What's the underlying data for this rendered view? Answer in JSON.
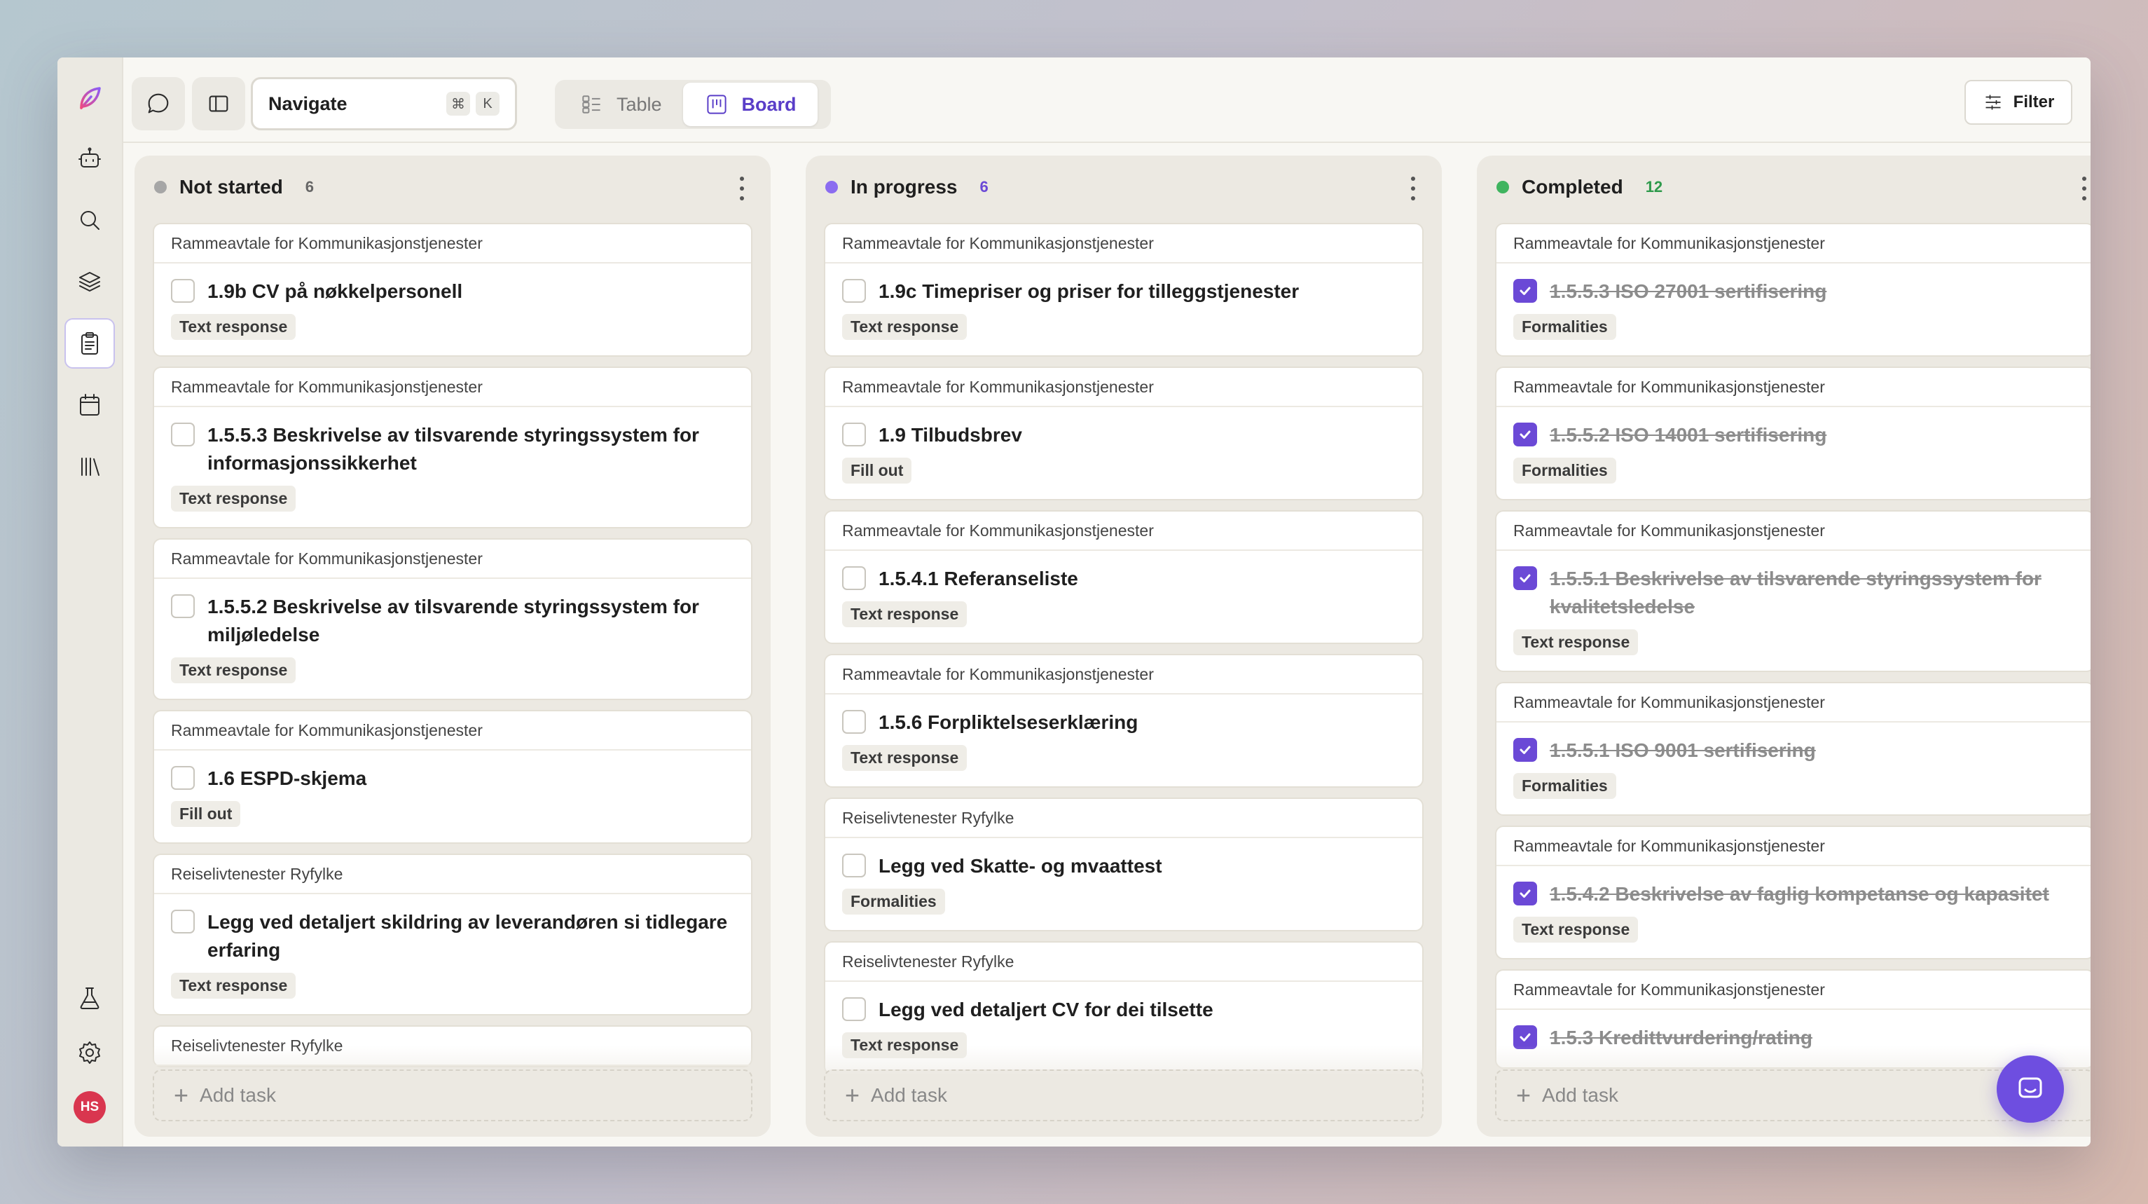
{
  "topbar": {
    "navigate_label": "Navigate",
    "shortcut_keys": [
      "⌘",
      "K"
    ],
    "views": [
      {
        "label": "Table",
        "active": false
      },
      {
        "label": "Board",
        "active": true
      }
    ],
    "filter_label": "Filter"
  },
  "sidebar": {
    "avatar_initials": "HS",
    "items": [
      "robot-icon",
      "search-icon",
      "layers-icon",
      "clipboard-icon",
      "calendar-icon",
      "library-icon"
    ],
    "bottom_items": [
      "flask-icon",
      "gear-icon"
    ]
  },
  "board": {
    "add_task_label": "Add task",
    "columns": [
      {
        "title": "Not started",
        "count": "6",
        "dot_color": "#a6a6a6",
        "count_color": "#666666",
        "cards": [
          {
            "project": "Rammeavtale for Kommunikasjonstjenester",
            "title": "1.9b CV på nøkkelpersonell",
            "tag": "Text response",
            "done": false
          },
          {
            "project": "Rammeavtale for Kommunikasjonstjenester",
            "title": "1.5.5.3 Beskrivelse av tilsvarende styringssystem for informasjonssikkerhet",
            "tag": "Text response",
            "done": false
          },
          {
            "project": "Rammeavtale for Kommunikasjonstjenester",
            "title": "1.5.5.2 Beskrivelse av tilsvarende styringssystem for miljøledelse",
            "tag": "Text response",
            "done": false
          },
          {
            "project": "Rammeavtale for Kommunikasjonstjenester",
            "title": "1.6 ESPD-skjema",
            "tag": "Fill out",
            "done": false
          },
          {
            "project": "Reiselivtenester Ryfylke",
            "title": "Legg ved detaljert skildring av leverandøren si tidlegare erfaring",
            "tag": "Text response",
            "done": false
          },
          {
            "project": "Reiselivtenester Ryfylke",
            "title": "",
            "tag": "",
            "done": false
          }
        ]
      },
      {
        "title": "In progress",
        "count": "6",
        "dot_color": "#8b6cf0",
        "count_color": "#6b49d6",
        "cards": [
          {
            "project": "Rammeavtale for Kommunikasjonstjenester",
            "title": "1.9c Timepriser og priser for tilleggstjenester",
            "tag": "Text response",
            "done": false
          },
          {
            "project": "Rammeavtale for Kommunikasjonstjenester",
            "title": "1.9 Tilbudsbrev",
            "tag": "Fill out",
            "done": false
          },
          {
            "project": "Rammeavtale for Kommunikasjonstjenester",
            "title": "1.5.4.1 Referanseliste",
            "tag": "Text response",
            "done": false
          },
          {
            "project": "Rammeavtale for Kommunikasjonstjenester",
            "title": "1.5.6 Forpliktelseserklæring",
            "tag": "Text response",
            "done": false
          },
          {
            "project": "Reiselivtenester Ryfylke",
            "title": "Legg ved Skatte- og mvaattest",
            "tag": "Formalities",
            "done": false
          },
          {
            "project": "Reiselivtenester Ryfylke",
            "title": "Legg ved detaljert CV for dei tilsette",
            "tag": "Text response",
            "done": false
          }
        ]
      },
      {
        "title": "Completed",
        "count": "12",
        "dot_color": "#3fb45f",
        "count_color": "#2f9a4c",
        "cards": [
          {
            "project": "Rammeavtale for Kommunikasjonstjenester",
            "title": "1.5.5.3 ISO 27001 sertifisering",
            "tag": "Formalities",
            "done": true
          },
          {
            "project": "Rammeavtale for Kommunikasjonstjenester",
            "title": "1.5.5.2 ISO 14001 sertifisering",
            "tag": "Formalities",
            "done": true
          },
          {
            "project": "Rammeavtale for Kommunikasjonstjenester",
            "title": "1.5.5.1 Beskrivelse av tilsvarende styringssystem for kvalitetsledelse",
            "tag": "Text response",
            "done": true
          },
          {
            "project": "Rammeavtale for Kommunikasjonstjenester",
            "title": "1.5.5.1 ISO 9001 sertifisering",
            "tag": "Formalities",
            "done": true
          },
          {
            "project": "Rammeavtale for Kommunikasjonstjenester",
            "title": "1.5.4.2 Beskrivelse av faglig kompetanse og kapasitet",
            "tag": "Text response",
            "done": true
          },
          {
            "project": "Rammeavtale for Kommunikasjonstjenester",
            "title": "1.5.3 Kredittvurdering/rating",
            "tag": "",
            "done": true
          }
        ]
      }
    ]
  },
  "colors": {
    "accent": "#6b49d6",
    "chat_fab": "#6e4ee0",
    "avatar": "#d9364f"
  }
}
